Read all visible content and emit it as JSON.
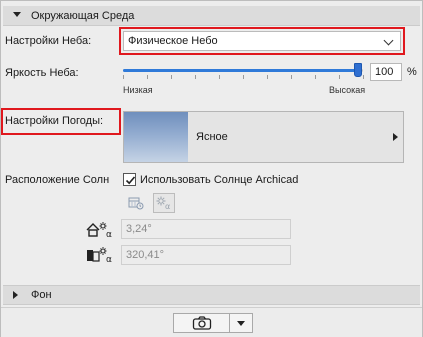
{
  "environment": {
    "header": "Окружающая Среда",
    "sky_settings_label": "Настройки Неба:",
    "sky_settings_value": "Физическое Небо",
    "sky_brightness_label": "Яркость Неба:",
    "brightness_value": "100",
    "brightness_unit": "%",
    "brightness_fraction": 0.98,
    "low_label": "Низкая",
    "high_label": "Высокая",
    "weather_label": "Настройки Погоды:",
    "weather_value": "Ясное",
    "sun_position_label": "Расположение Солн",
    "use_archicad_sun_label": "Использовать Солнце Archicad",
    "use_archicad_sun_checked": true,
    "altitude_value": "3,24°",
    "azimuth_value": "320,41°"
  },
  "background_section": {
    "header": "Фон"
  },
  "icons": {
    "sky_thumbnail": "clear-sky-thumbnail",
    "date_time": "calendar-clock-icon",
    "sun_angle": "sun-angle-icon",
    "altitude": "house-sun-altitude-icon",
    "azimuth": "building-sun-azimuth-icon",
    "camera": "camera-icon",
    "dropdown": "chevron-down-icon"
  },
  "colors": {
    "highlight": "#e0181e",
    "slider": "#2f7ad9"
  }
}
